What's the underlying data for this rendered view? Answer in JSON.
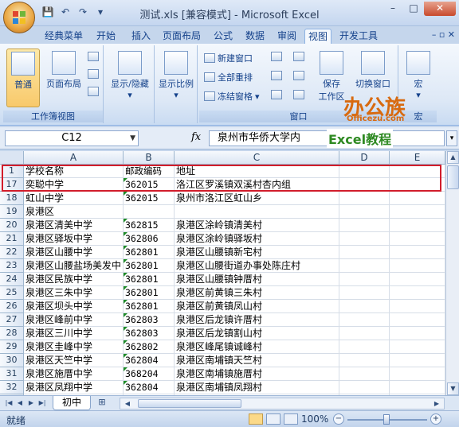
{
  "window": {
    "title": "测试.xls  [兼容模式] - Microsoft Excel",
    "min": "–",
    "max": "□",
    "close": "✕"
  },
  "quick_access": {
    "save": "💾",
    "undo": "↶",
    "redo": "↷",
    "customize": "▾"
  },
  "tabs": [
    "经典菜单",
    "开始",
    "插入",
    "页面布局",
    "公式",
    "数据",
    "审阅",
    "视图",
    "开发工具"
  ],
  "active_tab": "视图",
  "ribbon": {
    "workbook_views": {
      "label": "工作簿视图",
      "normal": "普通",
      "page_layout": "页面布局"
    },
    "show_hide": "显示/隐藏",
    "zoom": "显示比例",
    "window": {
      "label": "窗口",
      "new_window": "新建窗口",
      "arrange_all": "全部重排",
      "freeze_panes": "冻结窗格",
      "save_workspace": "保存\n工作区",
      "switch_windows": "切换窗口"
    },
    "macros": {
      "label": "宏",
      "button": "宏"
    }
  },
  "watermark": {
    "main": "办公族",
    "sub": "Officezu.com"
  },
  "formula_bar": {
    "name_box": "C12",
    "fx": "fx",
    "formula": "泉州市华侨大学内",
    "tag": "Excel教程"
  },
  "columns": [
    "A",
    "B",
    "C",
    "D",
    "E"
  ],
  "rows": [
    {
      "num": "1",
      "a": "学校名称",
      "b": "邮政编码",
      "c": "地址",
      "tri": false
    },
    {
      "num": "17",
      "a": "奕聪中学",
      "b": "362015",
      "c": "洛江区罗溪镇双溪村杏内组",
      "tri": true
    },
    {
      "num": "18",
      "a": "虹山中学",
      "b": "362015",
      "c": "泉州市洛江区虹山乡",
      "tri": true
    },
    {
      "num": "19",
      "a": "泉港区",
      "b": "",
      "c": "",
      "tri": false
    },
    {
      "num": "20",
      "a": "泉港区清美中学",
      "b": "362815",
      "c": "泉港区涂岭镇清美村",
      "tri": true
    },
    {
      "num": "21",
      "a": "泉港区驿坂中学",
      "b": "362806",
      "c": "泉港区涂岭镇驿坂村",
      "tri": true
    },
    {
      "num": "22",
      "a": "泉港区山腰中学",
      "b": "362801",
      "c": "泉港区山腰镇新宅村",
      "tri": true
    },
    {
      "num": "23",
      "a": "泉港区山腰盐场美发中",
      "b": "362801",
      "c": "泉港区山腰街道办事处陈庄村",
      "tri": true
    },
    {
      "num": "24",
      "a": "泉港区民族中学",
      "b": "362801",
      "c": "泉港区山腰镇钟厝村",
      "tri": true
    },
    {
      "num": "25",
      "a": "泉港区三朱中学",
      "b": "362801",
      "c": "泉港区前黄镇三朱村",
      "tri": true
    },
    {
      "num": "26",
      "a": "泉港区坝头中学",
      "b": "362801",
      "c": "泉港区前黄镇凤山村",
      "tri": true
    },
    {
      "num": "27",
      "a": "泉港区峰前中学",
      "b": "362803",
      "c": "泉港区后龙镇许厝村",
      "tri": true
    },
    {
      "num": "28",
      "a": "泉港区三川中学",
      "b": "362803",
      "c": "泉港区后龙镇割山村",
      "tri": true
    },
    {
      "num": "29",
      "a": "泉港区圭峰中学",
      "b": "362802",
      "c": "泉港区峰尾镇诚峰村",
      "tri": true
    },
    {
      "num": "30",
      "a": "泉港区天竺中学",
      "b": "362804",
      "c": "泉港区南埔镇天竺村",
      "tri": true
    },
    {
      "num": "31",
      "a": "泉港区施厝中学",
      "b": "368204",
      "c": "泉港区南埔镇施厝村",
      "tri": true
    },
    {
      "num": "32",
      "a": "泉港区凤翔中学",
      "b": "362804",
      "c": "泉港区南埔镇凤翔村",
      "tri": true
    },
    {
      "num": "33",
      "a": "",
      "b": "",
      "c": "",
      "tri": false
    }
  ],
  "sheet_tab": "初中",
  "status": {
    "ready": "就绪",
    "zoom": "100%"
  }
}
